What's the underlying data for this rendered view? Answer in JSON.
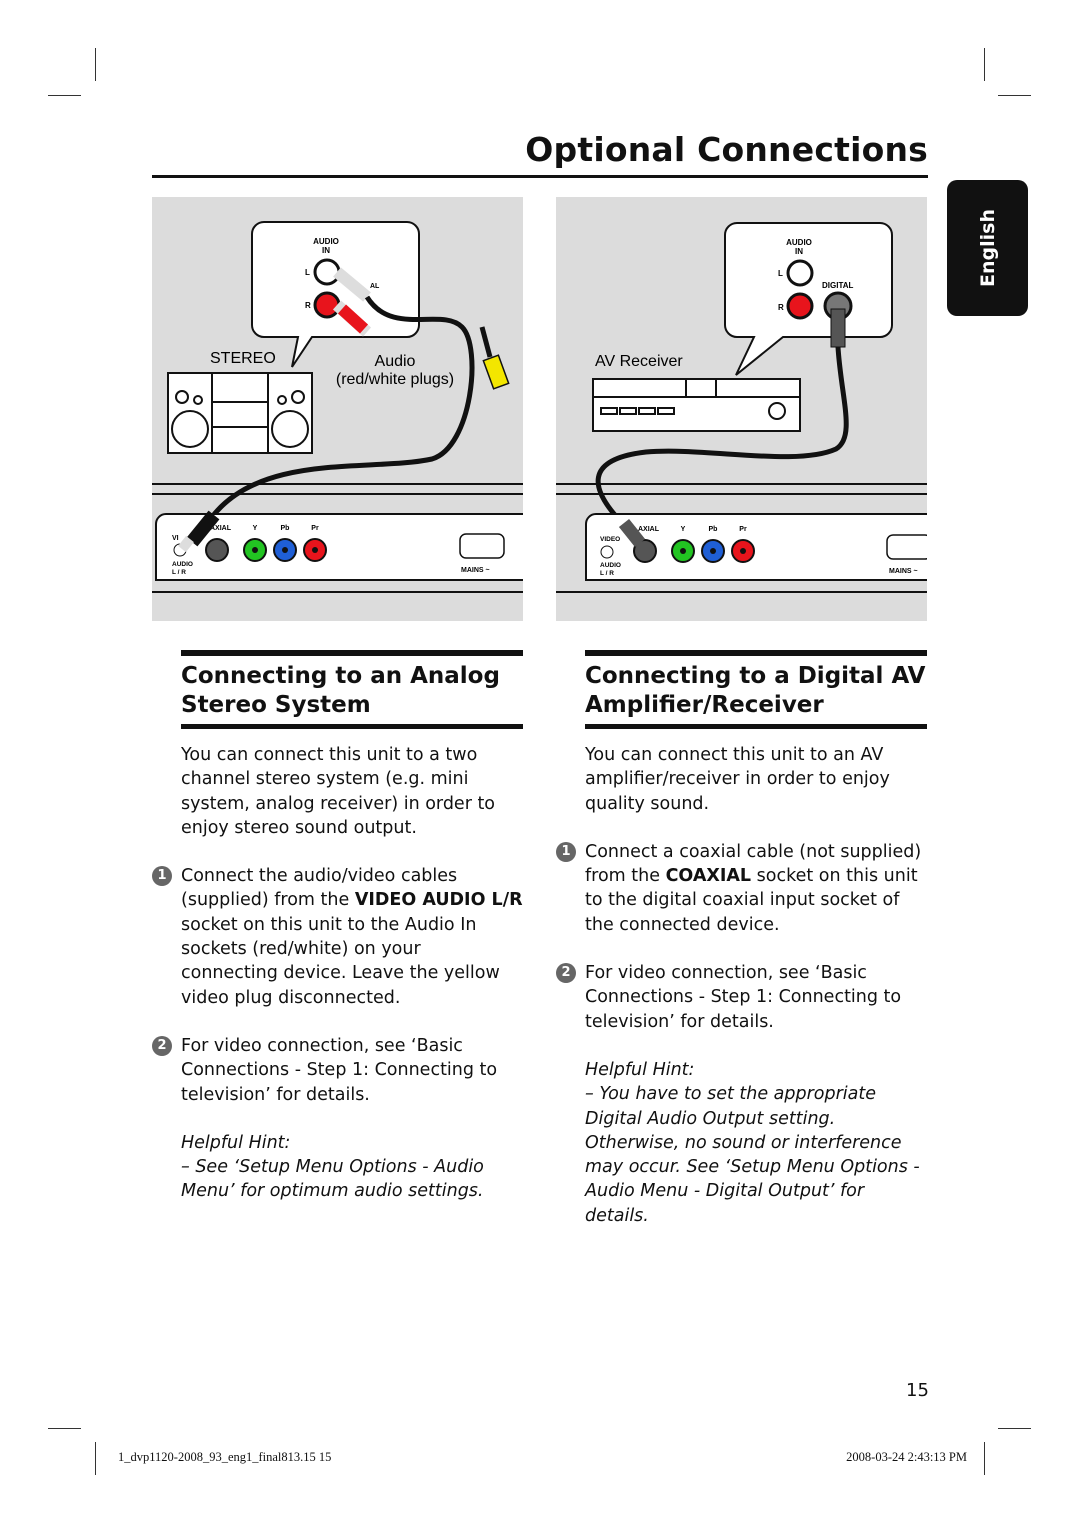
{
  "header": {
    "title": "Optional Connections",
    "language_tab": "English"
  },
  "colors": {
    "red_jack": "#e8141c",
    "green_jack": "#22c422",
    "blue_jack": "#1f5fd6",
    "yellow_plug": "#f3e600",
    "diagram_bg": "#dcdcdc",
    "tab_bg": "#111111"
  },
  "diagram_left": {
    "audio_in": [
      "AUDIO",
      "IN"
    ],
    "jack_l": "L",
    "jack_r": "R",
    "coaxial_partial": "AL",
    "device": "STEREO",
    "cable_label": "Audio",
    "cable_sublabel": "(red/white plugs)",
    "panel": {
      "video": "VI",
      "coaxial": "AXIAL",
      "y": "Y",
      "pb": "Pb",
      "pr": "Pr",
      "audio": "AUDIO",
      "lr": "L / R",
      "mains": "MAINS ~"
    }
  },
  "diagram_right": {
    "audio_in": [
      "AUDIO",
      "IN"
    ],
    "jack_l": "L",
    "jack_r": "R",
    "digital": "DIGITAL",
    "device": "AV Receiver",
    "panel": {
      "video": "VIDEO",
      "coaxial": "AXIAL",
      "y": "Y",
      "pb": "Pb",
      "pr": "Pr",
      "audio": "AUDIO",
      "lr": "L / R",
      "mains": "MAINS ~"
    }
  },
  "left": {
    "heading": [
      "Connecting to an Analog",
      "Stereo System"
    ],
    "intro": "You can connect this unit to a two channel stereo system (e.g. mini system, analog receiver) in order to enjoy stereo sound output.",
    "steps": [
      {
        "num": "1",
        "pre": "Connect the audio/video cables (supplied) from the ",
        "bold": "VIDEO AUDIO L/R",
        "post": " socket on this unit to the Audio In sockets (red/white) on your connecting device. Leave the yellow video plug disconnected."
      },
      {
        "num": "2",
        "text": "For video connection, see ‘Basic Connections - Step 1: Connecting to television’ for details."
      }
    ],
    "hint_title": "Helpful Hint:",
    "hint": "–  See ‘Setup Menu Options - Audio Menu’ for optimum audio settings."
  },
  "right": {
    "heading": [
      "Connecting to a Digital AV",
      "Amplifier/Receiver"
    ],
    "intro": "You can connect this unit to an AV amplifier/receiver in order to enjoy quality sound.",
    "steps": [
      {
        "num": "1",
        "pre": "Connect a coaxial cable (not supplied) from the ",
        "bold": "COAXIAL",
        "post": " socket on this unit to the digital coaxial input socket of the connected device."
      },
      {
        "num": "2",
        "text": "For video connection, see ‘Basic Connections - Step 1: Connecting to television’ for details."
      }
    ],
    "hint_title": "Helpful Hint:",
    "hint": "–  You have to set the appropriate Digital Audio Output setting. Otherwise, no sound or interference may occur. See ‘Setup Menu Options - Audio Menu - Digital Output’ for details."
  },
  "page_number": "15",
  "footer": {
    "file": "1_dvp1120-2008_93_eng1_final813.15   15",
    "timestamp": "2008-03-24   2:43:13 PM"
  }
}
